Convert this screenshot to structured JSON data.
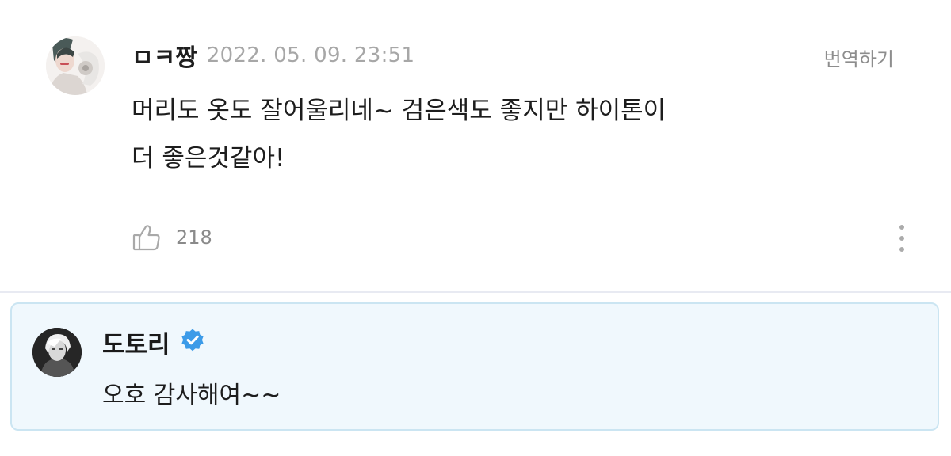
{
  "comment": {
    "author": "ㅁㅋ짱",
    "timestamp": "2022. 05. 09. 23:51",
    "translate_label": "번역하기",
    "lines": [
      "머리도 옷도 잘어울리네~ 검은색도 좋지만 하이톤이",
      "더 좋은것같아!"
    ],
    "like_count": "218",
    "icons": {
      "like": "thumbs-up-icon",
      "more": "more-vertical-icon"
    }
  },
  "reply": {
    "author": "도토리",
    "text": "오호 감사해여~~",
    "icons": {
      "verified": "verified-badge-icon"
    }
  },
  "colors": {
    "reply_background": "#f0f8fd",
    "reply_border": "#cbe5f2",
    "verified_badge": "#3c9be8"
  }
}
